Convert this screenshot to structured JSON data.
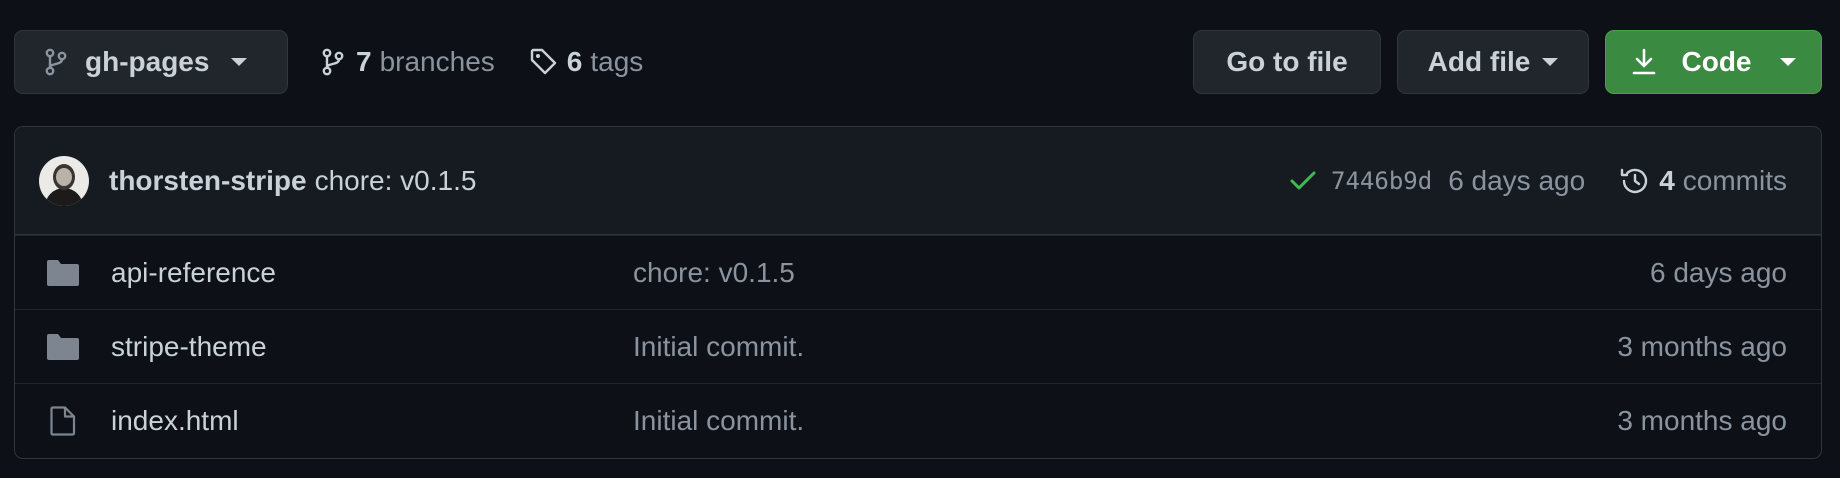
{
  "toolbar": {
    "branch": "gh-pages",
    "branches_count": "7",
    "branches_label": "branches",
    "tags_count": "6",
    "tags_label": "tags",
    "goto_label": "Go to file",
    "add_label": "Add file",
    "code_label": "Code"
  },
  "latest_commit": {
    "author": "thorsten-stripe",
    "message": "chore: v0.1.5",
    "sha": "7446b9d",
    "time": "6 days ago",
    "commits_count": "4",
    "commits_label": "commits"
  },
  "files": [
    {
      "type": "folder",
      "name": "api-reference",
      "commit": "chore: v0.1.5",
      "time": "6 days ago"
    },
    {
      "type": "folder",
      "name": "stripe-theme",
      "commit": "Initial commit.",
      "time": "3 months ago"
    },
    {
      "type": "file",
      "name": "index.html",
      "commit": "Initial commit.",
      "time": "3 months ago"
    }
  ],
  "colors": {
    "background": "#0d1117",
    "code_button": "#3a8a42",
    "check": "#3fb950"
  }
}
